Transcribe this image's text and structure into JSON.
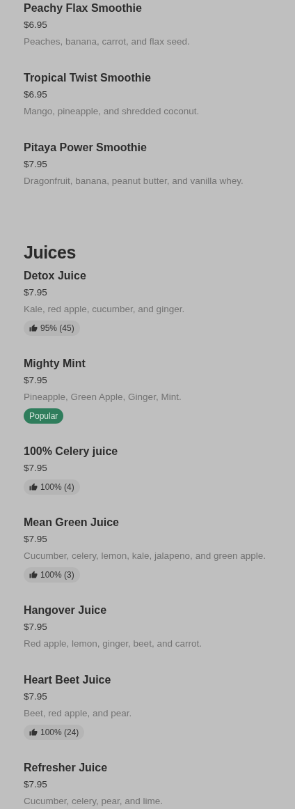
{
  "sections": [
    {
      "items": [
        {
          "name": "Peachy Flax Smoothie",
          "price": "$6.95",
          "description": "Peaches, banana, carrot, and flax seed."
        },
        {
          "name": "Tropical Twist Smoothie",
          "price": "$6.95",
          "description": "Mango, pineapple, and shredded coconut."
        },
        {
          "name": "Pitaya Power Smoothie",
          "price": "$7.95",
          "description": "Dragonfruit, banana, peanut butter, and vanilla whey."
        }
      ]
    },
    {
      "title": "Juices",
      "items": [
        {
          "name": "Detox Juice",
          "price": "$7.95",
          "description": "Kale, red apple, cucumber, and ginger.",
          "badge": {
            "kind": "rating",
            "text": "95% (45)"
          }
        },
        {
          "name": "Mighty Mint",
          "price": "$7.95",
          "description": "Pineapple, Green Apple, Ginger, Mint.",
          "badge": {
            "kind": "popular",
            "text": "Popular"
          }
        },
        {
          "name": "100% Celery juice",
          "price": "$7.95",
          "badge": {
            "kind": "rating",
            "text": "100% (4)"
          }
        },
        {
          "name": "Mean Green Juice",
          "price": "$7.95",
          "description": "Cucumber, celery, lemon, kale, jalapeno, and green apple.",
          "badge": {
            "kind": "rating",
            "text": "100% (3)"
          }
        },
        {
          "name": "Hangover Juice",
          "price": "$7.95",
          "description": "Red apple, lemon, ginger, beet, and carrot."
        },
        {
          "name": "Heart Beet Juice",
          "price": "$7.95",
          "description": "Beet, red apple, and pear.",
          "badge": {
            "kind": "rating",
            "text": "100% (24)"
          }
        },
        {
          "name": "Refresher Juice",
          "price": "$7.95",
          "description": "Cucumber, celery, pear, and lime."
        }
      ]
    }
  ]
}
